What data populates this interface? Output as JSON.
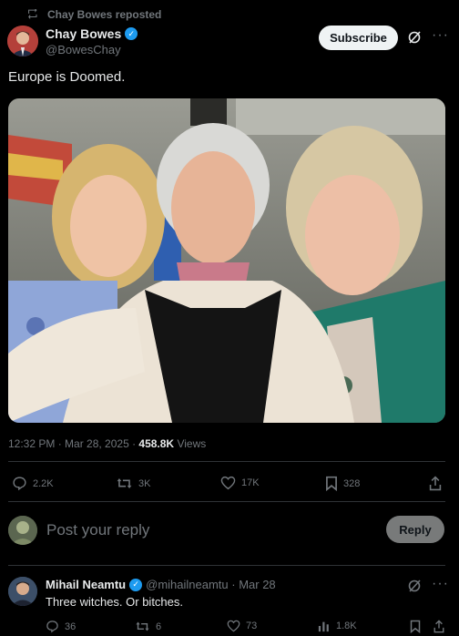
{
  "repost": {
    "label": "Chay Bowes reposted"
  },
  "author": {
    "name": "Chay Bowes",
    "handle": "@BowesChay"
  },
  "header": {
    "subscribe_label": "Subscribe",
    "more_label": "···"
  },
  "tweet": {
    "text": "Europe is Doomed.",
    "time": "12:32 PM · Mar 28, 2025 · ",
    "views_count": "458.8K",
    "views_label": " Views"
  },
  "actions": {
    "replies": "2.2K",
    "reposts": "3K",
    "likes": "17K",
    "bookmarks": "328"
  },
  "composer": {
    "placeholder": "Post your reply",
    "reply_label": "Reply"
  },
  "comment": {
    "name": "Mihail Neamtu",
    "meta": "@mihailneamtu · Mar 28",
    "text": "Three witches. Or bitches.",
    "more_label": "···",
    "replies": "36",
    "reposts": "6",
    "likes": "73",
    "views": "1.8K"
  },
  "colors": {
    "accent": "#1d9bf0",
    "background": "#000000",
    "muted": "#71767b"
  }
}
